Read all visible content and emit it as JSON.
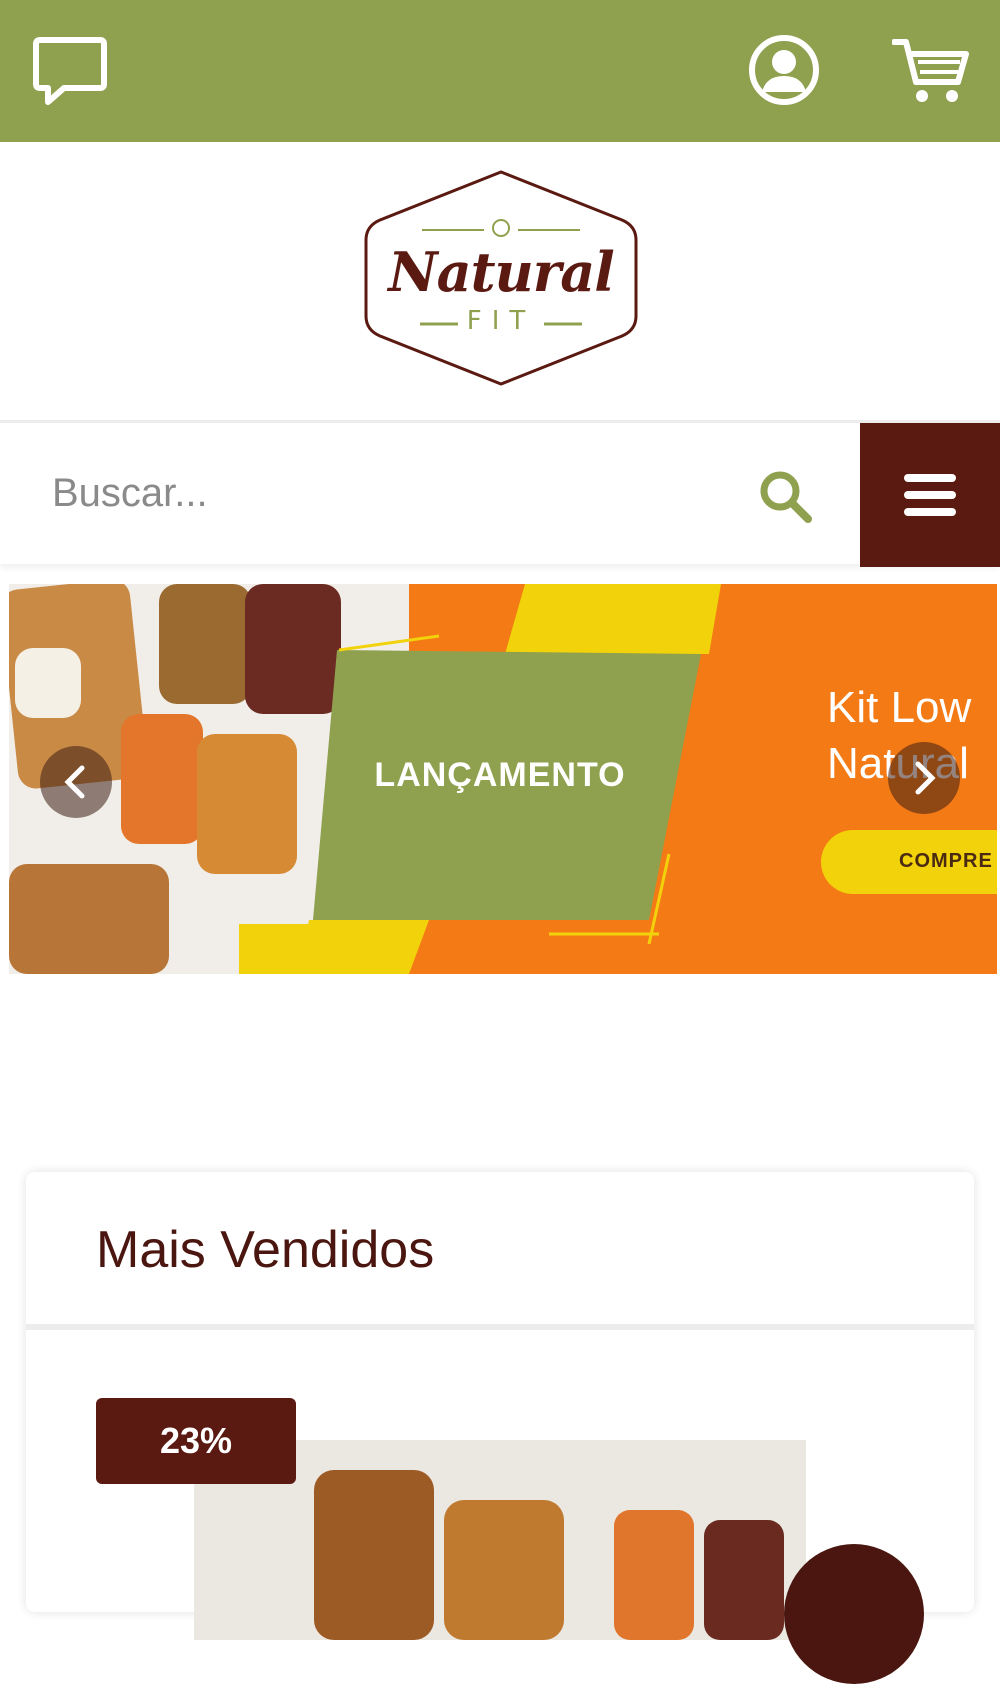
{
  "header": {
    "chat_icon": "chat-bubble-icon",
    "account_icon": "user-circle-icon",
    "cart_icon": "shopping-cart-icon",
    "bar_color": "#8fa04f"
  },
  "logo": {
    "word": "Natural",
    "sub": "FIT",
    "brand_color": "#5b1a11",
    "accent_color": "#8fa04f"
  },
  "search": {
    "placeholder": "Buscar...",
    "search_icon": "search-icon",
    "menu_icon": "hamburger-menu-icon"
  },
  "banner": {
    "badge_text": "LANÇAMENTO",
    "slogan": "Kit Low\nNatural",
    "cta": "COMPRE",
    "prev_icon": "chevron-left-icon",
    "next_icon": "chevron-right-icon"
  },
  "best_sellers": {
    "title": "Mais Vendidos",
    "discount": "23%"
  }
}
